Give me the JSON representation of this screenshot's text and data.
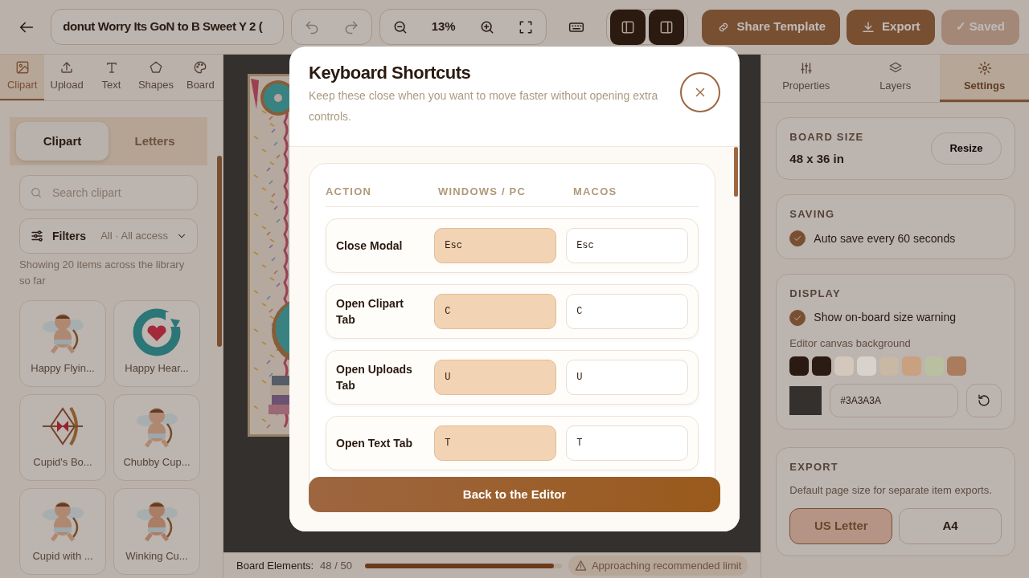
{
  "toolbar": {
    "title": "donut Worry Its GoN to B Sweet Y 2 (",
    "history": [
      {
        "kind": "undo",
        "disabled": true
      },
      {
        "kind": "redo",
        "disabled": true
      }
    ],
    "zoom": {
      "reading": "13%"
    },
    "panels": [
      {
        "kind": "left",
        "on": true
      },
      {
        "kind": "right",
        "on": true
      }
    ],
    "actions": [
      {
        "label": "Share Template",
        "kind": "share",
        "disabled": false
      },
      {
        "label": "Export",
        "kind": "export",
        "disabled": false
      },
      {
        "label": "✓ Saved",
        "kind": "saved",
        "disabled": true
      }
    ]
  },
  "left_tabs": [
    {
      "label": "Clipart",
      "selected": true
    },
    {
      "label": "Upload",
      "selected": false
    },
    {
      "label": "Text",
      "selected": false
    },
    {
      "label": "Shapes",
      "selected": false
    },
    {
      "label": "Board",
      "selected": false
    }
  ],
  "segments": [
    {
      "label": "Clipart",
      "selected": true
    },
    {
      "label": "Letters",
      "selected": false
    }
  ],
  "search": {
    "placeholder": "Search clipart"
  },
  "filters": {
    "label": "Filters",
    "value": "All · All access"
  },
  "result_note": "Showing 20 items across the library so far",
  "clipart": [
    {
      "name": "Happy Flyin..."
    },
    {
      "name": "Happy Hear..."
    },
    {
      "name": "Cupid's Bo..."
    },
    {
      "name": "Chubby Cup..."
    },
    {
      "name": "Cupid with ..."
    },
    {
      "name": "Winking Cu..."
    }
  ],
  "right_tabs": [
    {
      "label": "Properties",
      "selected": false
    },
    {
      "label": "Layers",
      "selected": false
    },
    {
      "label": "Settings",
      "selected": true
    }
  ],
  "settings": {
    "board_size": {
      "heading": "BOARD SIZE",
      "value": "48 x 36 in",
      "button": "Resize"
    },
    "saving": {
      "heading": "SAVING",
      "option": {
        "label": "Auto save every 60 seconds",
        "checked": true
      }
    },
    "display": {
      "heading": "DISPLAY",
      "option": {
        "label": "Show on-board size warning",
        "checked": true
      },
      "swatch_label": "Editor canvas background",
      "swatches": [
        {
          "color": "#2a1a12"
        },
        {
          "color": "#2c1b12"
        },
        {
          "color": "#d4c8bc"
        },
        {
          "color": "#d8d2cc"
        },
        {
          "color": "#c8b8a4"
        },
        {
          "color": "#c9a080"
        },
        {
          "color": "#b8c0a0"
        },
        {
          "color": "#a87c5c"
        }
      ],
      "hex_value": "#3A3A3A"
    },
    "export": {
      "heading": "EXPORT",
      "note": "Default page size for separate item exports.",
      "options": [
        {
          "label": "US Letter",
          "selected": true
        },
        {
          "label": "A4",
          "selected": false
        }
      ]
    }
  },
  "status_bar": {
    "label": "Board Elements:",
    "count": "48 / 50",
    "level": 0.96,
    "warning": "Approaching recommended limit"
  },
  "modal": {
    "title": "Keyboard Shortcuts",
    "subtitle": "Keep these close when you want to move faster without opening extra controls.",
    "columns": [
      "ACTION",
      "WINDOWS / PC",
      "MACOS"
    ],
    "rows": [
      {
        "action": "Close Modal",
        "windows": "Esc",
        "mac": "Esc"
      },
      {
        "action": "Open Clipart Tab",
        "windows": "C",
        "mac": "C"
      },
      {
        "action": "Open Uploads Tab",
        "windows": "U",
        "mac": "U"
      },
      {
        "action": "Open Text Tab",
        "windows": "T",
        "mac": "T"
      }
    ],
    "button": "Back to the Editor"
  }
}
